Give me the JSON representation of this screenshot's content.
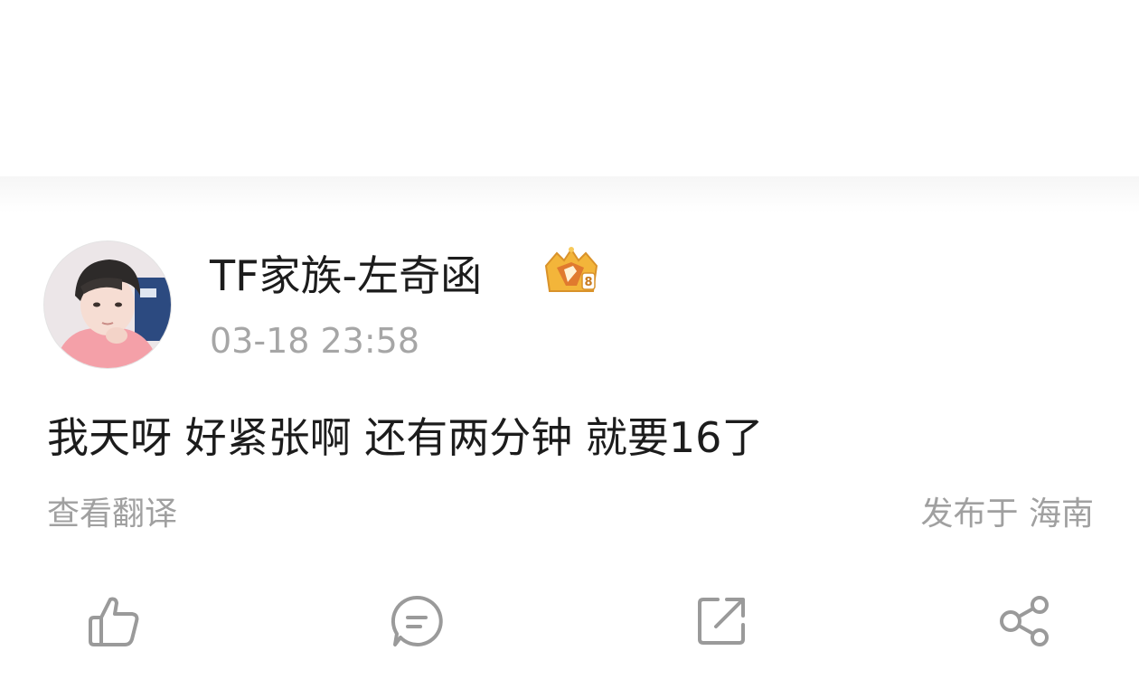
{
  "post": {
    "username": "TF家族-左奇函",
    "timestamp": "03-18 23:58",
    "text": "我天呀 好紧张啊 还有两分钟 就要16了",
    "translate_label": "查看翻译",
    "location": "发布于 海南",
    "badge_icon": "crown-badge-icon",
    "avatar": "user-avatar"
  },
  "actions": [
    {
      "icon": "thumbs-up-icon"
    },
    {
      "icon": "comment-icon"
    },
    {
      "icon": "repost-icon"
    },
    {
      "icon": "share-icon"
    }
  ],
  "colors": {
    "text_primary": "#1c1c1c",
    "text_secondary": "#a0a0a0",
    "icon_gray": "#9a9a9a",
    "badge_gold": "#f3b53a"
  }
}
